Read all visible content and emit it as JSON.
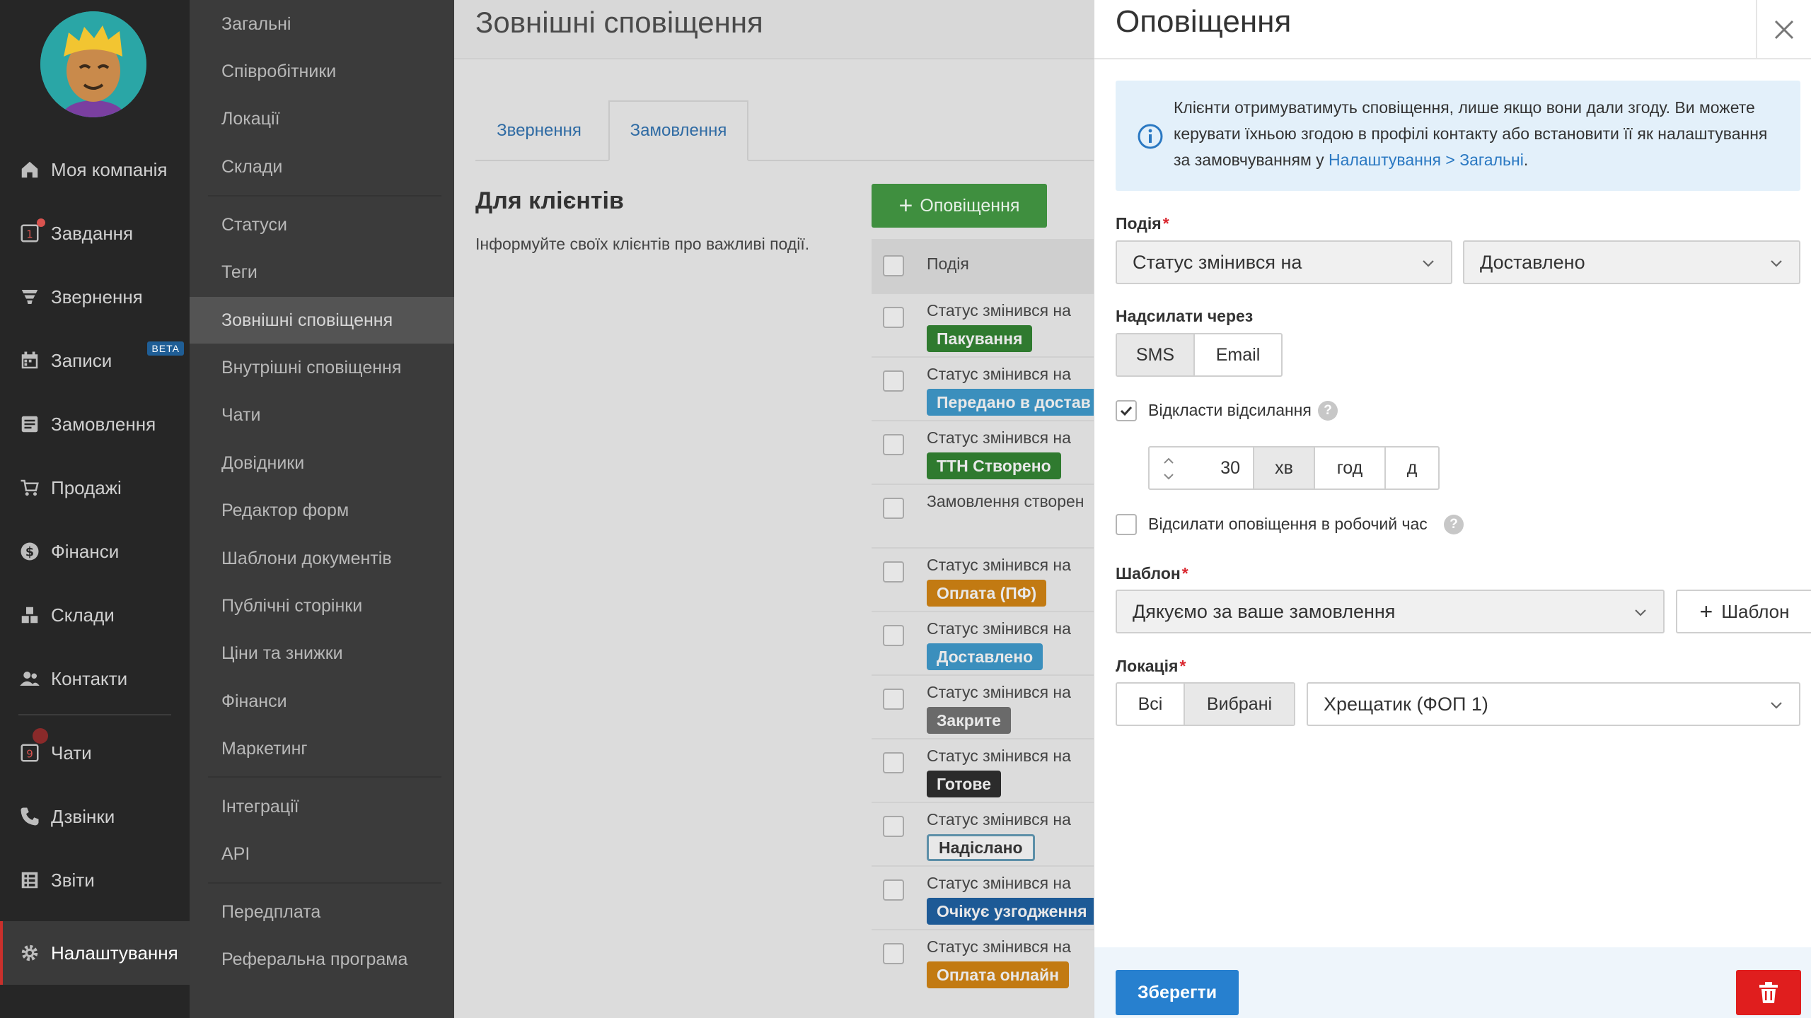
{
  "nav": {
    "items": [
      {
        "label": "Моя компанія",
        "icon": "home-icon"
      },
      {
        "label": "Завдання",
        "icon": "task-icon",
        "badge": "1"
      },
      {
        "label": "Звернення",
        "icon": "funnel-icon"
      },
      {
        "label": "Записи",
        "icon": "calendar-icon",
        "tag": "BETA"
      },
      {
        "label": "Замовлення",
        "icon": "order-icon"
      },
      {
        "label": "Продажі",
        "icon": "cart-icon"
      },
      {
        "label": "Фінанси",
        "icon": "dollar-icon"
      },
      {
        "label": "Склади",
        "icon": "boxes-icon"
      },
      {
        "label": "Контакти",
        "icon": "contacts-icon"
      },
      {
        "label": "Чати",
        "icon": "chat-icon",
        "badge": "9"
      },
      {
        "label": "Дзвінки",
        "icon": "phone-icon"
      },
      {
        "label": "Звіти",
        "icon": "report-icon"
      },
      {
        "label": "Налаштування",
        "icon": "gear-icon"
      }
    ]
  },
  "submenu": {
    "items": [
      "Загальні",
      "Співробітники",
      "Локації",
      "Склади",
      "Статуси",
      "Теги",
      "Зовнішні сповіщення",
      "Внутрішні сповіщення",
      "Чати",
      "Довідники",
      "Редактор форм",
      "Шаблони документів",
      "Публічні сторінки",
      "Ціни та знижки",
      "Фінанси",
      "Маркетинг",
      "Інтеграції",
      "API",
      "Передплата",
      "Реферальна програма"
    ],
    "active": "Зовнішні сповіщення"
  },
  "main": {
    "title": "Зовнішні сповіщення",
    "tabs": [
      "Звернення",
      "Замовлення"
    ],
    "active_tab": "Замовлення",
    "section_title": "Для клієнтів",
    "section_desc": "Інформуйте своїх клієнтів про важливі події.",
    "add_button": "Оповіщення",
    "table": {
      "header": "Подія",
      "rows": [
        {
          "event": "Статус змінився на",
          "status": "Пакування",
          "color": "#2f7a2f"
        },
        {
          "event": "Статус змінився на",
          "status": "Передано в достав",
          "color": "#3b8fbd"
        },
        {
          "event": "Статус змінився на",
          "status": "ТТН Створено",
          "color": "#2f7a2f"
        },
        {
          "event": "Замовлення створен",
          "status": "",
          "color": ""
        },
        {
          "event": "Статус змінився на",
          "status": "Оплата (ПФ)",
          "color": "#c27a12"
        },
        {
          "event": "Статус змінився на",
          "status": "Доставлено",
          "color": "#3b8fbd"
        },
        {
          "event": "Статус змінився на",
          "status": "Закрите",
          "color": "#6a6a6a"
        },
        {
          "event": "Статус змінився на",
          "status": "Готове",
          "color": "#2b2b2b"
        },
        {
          "event": "Статус змінився на",
          "status": "Надіслано",
          "color": "outline"
        },
        {
          "event": "Статус змінився на",
          "status": "Очікує узгодження",
          "color": "#1d5a96"
        },
        {
          "event": "Статус змінився на",
          "status": "Оплата онлайн",
          "color": "#c27a12"
        }
      ]
    }
  },
  "drawer": {
    "title": "Оповіщення",
    "info": {
      "text": "Клієнти отримуватимуть сповіщення, лише якщо вони дали згоду. Ви можете керувати їхньою згодою в профілі контакту або встановити її як налаштування за замовчуванням у",
      "link": "Налаштування > Загальні",
      "end": "."
    },
    "event": {
      "label": "Подія",
      "trigger": "Статус змінився на",
      "status": "Доставлено"
    },
    "channel": {
      "label": "Надсилати через",
      "options": [
        "SMS",
        "Email"
      ],
      "selected": "SMS"
    },
    "delay": {
      "label": "Відкласти відсилання",
      "checked": true,
      "value": "30",
      "units": [
        "хв",
        "год",
        "д"
      ],
      "selected_unit": "хв"
    },
    "working_hours": {
      "label": "Відсилати оповіщення в робочий час",
      "checked": false
    },
    "template": {
      "label": "Шаблон",
      "value": "Дякуємо за ваше замовлення",
      "add_label": "Шаблон"
    },
    "location": {
      "label": "Локація",
      "options": [
        "Всі",
        "Вибрані"
      ],
      "selected": "Вибрані",
      "value": "Хрещатик (ФОП 1)"
    },
    "save_label": "Зберегти",
    "colors": {
      "primary": "#2780cf",
      "danger": "#e01e1e",
      "info_bg": "#e3f0fa"
    }
  }
}
